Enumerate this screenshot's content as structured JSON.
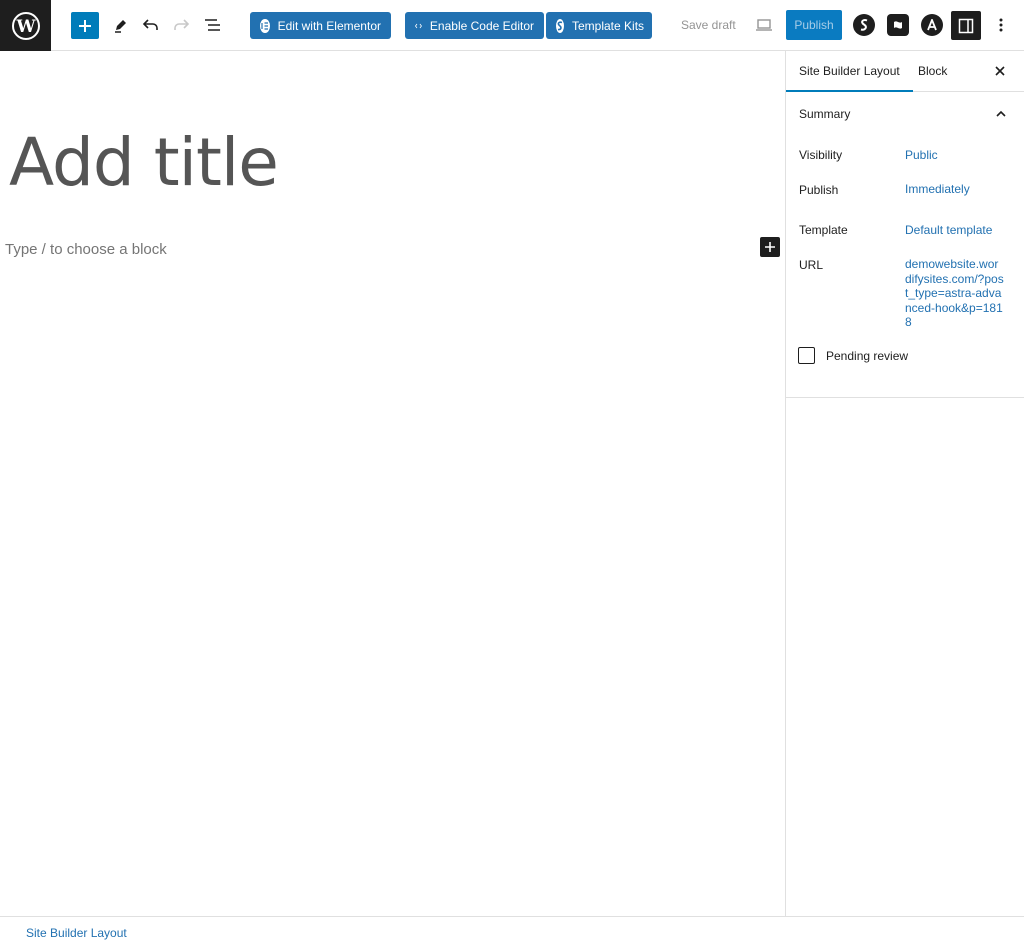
{
  "toolbar": {
    "edit_elementor": "Edit with Elementor",
    "enable_code_editor": "Enable Code Editor",
    "template_kits": "Template Kits",
    "save_draft": "Save draft",
    "publish": "Publish",
    "icons": [
      "wordpress-logo-icon",
      "plus-icon",
      "pencil-icon",
      "undo-icon",
      "redo-icon",
      "list-view-icon",
      "elementor-icon",
      "code-icon",
      "starter-templates-icon",
      "preview-desktop-icon",
      "spectra-icon",
      "flag-icon",
      "astra-icon",
      "sidebar-toggle-icon",
      "more-options-icon"
    ],
    "accent_color": "#007cba",
    "button_color": "#2271b1"
  },
  "editor": {
    "title_placeholder": "Add title",
    "block_placeholder": "Type / to choose a block"
  },
  "sidebar": {
    "tabs": [
      "Site Builder Layout",
      "Block"
    ],
    "summary_title": "Summary",
    "rows": {
      "visibility_label": "Visibility",
      "visibility_value": "Public",
      "publish_label": "Publish",
      "publish_value": "Immediately",
      "template_label": "Template",
      "template_value": "Default template",
      "url_label": "URL",
      "url_value": "demowebsite.wordifysites.com/?post_type=astra-advanced-hook&p=1818"
    },
    "pending_review": "Pending review"
  },
  "footer": {
    "breadcrumb": "Site Builder Layout"
  }
}
